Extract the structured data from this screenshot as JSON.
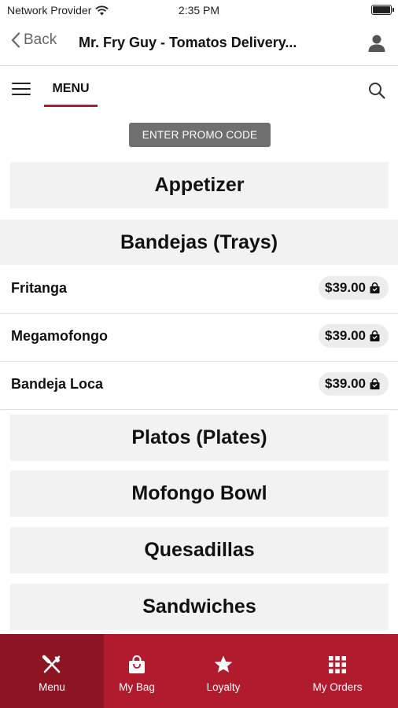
{
  "status_bar": {
    "carrier": "Network Provider",
    "time": "2:35 PM"
  },
  "nav": {
    "back_label": "Back",
    "title": "Mr. Fry Guy - Tomatos Delivery..."
  },
  "menu_bar": {
    "tab_label": "MENU"
  },
  "promo": {
    "label": "ENTER PROMO CODE"
  },
  "categories": {
    "appetizer": "Appetizer",
    "bandejas": "Bandejas (Trays)",
    "platos": "Platos (Plates)",
    "mofongo_bowl": "Mofongo Bowl",
    "quesadillas": "Quesadillas",
    "sandwiches": "Sandwiches"
  },
  "items": [
    {
      "name": "Fritanga",
      "price": "$39.00"
    },
    {
      "name": "Megamofongo",
      "price": "$39.00"
    },
    {
      "name": "Bandeja Loca",
      "price": "$39.00"
    }
  ],
  "tab_bar": {
    "tabs": [
      {
        "label": "Menu",
        "icon": "fork-knife-icon",
        "active": true
      },
      {
        "label": "My Bag",
        "icon": "shopping-bag-icon",
        "active": false
      },
      {
        "label": "Loyalty",
        "icon": "star-icon",
        "active": false
      },
      {
        "label": "My Orders",
        "icon": "grid-icon",
        "active": false
      }
    ]
  },
  "colors": {
    "accent": "#b01c2e",
    "accent_dark": "#8d1423",
    "promo_button": "#6f6f6f",
    "card_background": "#f2f2f2"
  }
}
